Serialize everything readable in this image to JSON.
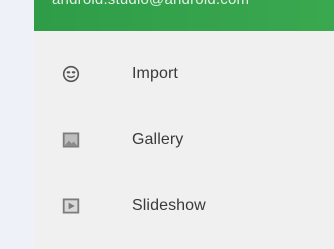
{
  "header": {
    "email": "android.studio@android.com",
    "color": "#2f9c48"
  },
  "menu": {
    "items": [
      {
        "label": "Import",
        "icon": "face-icon"
      },
      {
        "label": "Gallery",
        "icon": "gallery-icon"
      },
      {
        "label": "Slideshow",
        "icon": "slideshow-icon"
      }
    ]
  }
}
